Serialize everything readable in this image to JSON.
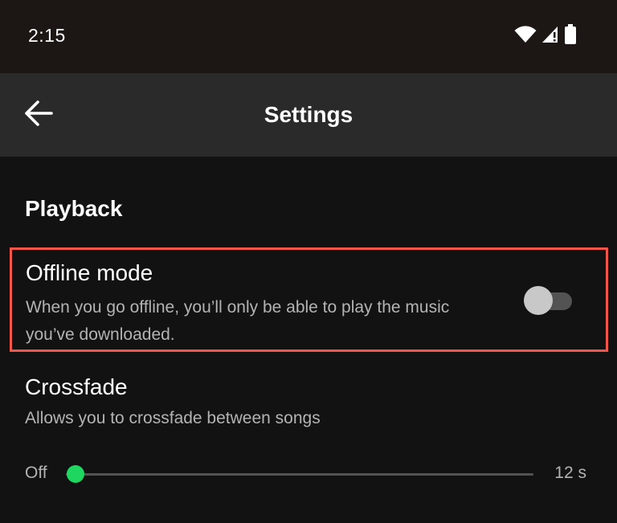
{
  "status_bar": {
    "time": "2:15",
    "icons": [
      "wifi-icon",
      "cell-signal-icon",
      "battery-icon"
    ]
  },
  "app_bar": {
    "title": "Settings",
    "back_icon": "arrow-left-icon"
  },
  "section": {
    "title": "Playback"
  },
  "offline_mode": {
    "title": "Offline mode",
    "description": "When you go offline, you’ll only be able to play the music you’ve downloaded.",
    "enabled": false
  },
  "crossfade": {
    "title": "Crossfade",
    "description": "Allows you to crossfade between songs",
    "min_label": "Off",
    "max_label": "12 s",
    "value_fraction": 0.02
  },
  "colors": {
    "background": "#121212",
    "status_bar": "#1c1714",
    "app_bar": "#2a2a2a",
    "accent": "#1ed760",
    "highlight_border": "#f0574a",
    "secondary_text": "#b3b3b3"
  }
}
